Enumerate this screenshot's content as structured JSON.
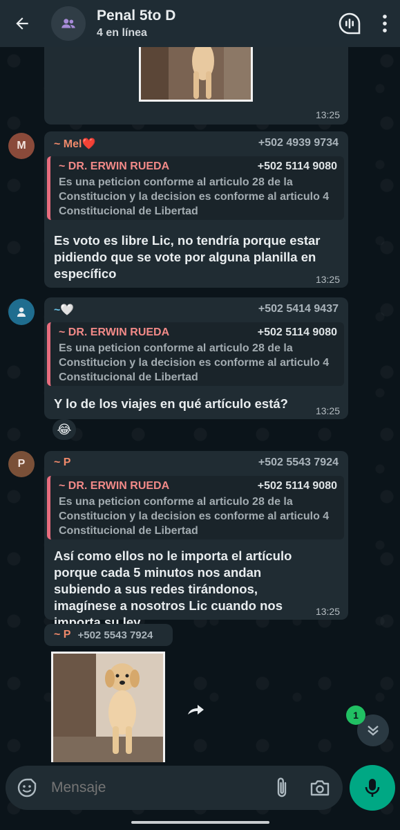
{
  "header": {
    "title": "Penal 5to D",
    "subtitle": "4 en línea"
  },
  "messages": [
    {
      "time": "13:25"
    },
    {
      "avatar_letter": "M",
      "sender": "~ Mel❤️",
      "phone": "+502 4939 9734",
      "quote_author": "~ DR. ERWIN RUEDA",
      "quote_phone": "+502 5114 9080",
      "quote_text": "Es una peticion conforme al articulo 28 de la Constitucion y la decision es conforme al articulo 4 Constitucional de  Libertad",
      "text": "Es voto es libre Lic, no tendría porque estar pidiendo que se vote por alguna planilla en específico",
      "time": "13:25"
    },
    {
      "sender": "~🤍",
      "phone": "+502 5414 9437",
      "quote_author": "~ DR. ERWIN RUEDA",
      "quote_phone": "+502 5114 9080",
      "quote_text": "Es una peticion conforme al articulo 28 de la Constitucion y la decision es conforme al articulo 4 Constitucional de  Libertad",
      "text": "Y lo de los viajes en qué artículo está?",
      "time": "13:25",
      "reaction": "😂"
    },
    {
      "avatar_letter": "P",
      "sender": "~ P",
      "phone": "+502 5543 7924",
      "quote_author": "~ DR. ERWIN RUEDA",
      "quote_phone": "+502 5114 9080",
      "quote_text": "Es una peticion conforme al articulo 28 de la Constitucion y la decision es conforme al articulo 4 Constitucional de  Libertad",
      "text": "Así como ellos no le importa el artículo porque cada 5 minutos nos andan subiendo a sus redes tirándonos, imagínese a nosotros Lic cuando nos importa su ley",
      "time": "13:25"
    },
    {
      "sender": "~ P",
      "phone": "+502 5543 7924"
    }
  ],
  "unread_count": "1",
  "composer": {
    "placeholder": "Mensaje"
  },
  "colors": {
    "header_bg": "#1f2c34",
    "bubble_bg": "#202c33",
    "accent_green": "#00a884",
    "quote_bar": "#e86d7e"
  },
  "icons": [
    "back-arrow-icon",
    "group-icon",
    "voice-chat-icon",
    "more-vert-icon",
    "forward-icon",
    "chevron-down-icon",
    "sticker-icon",
    "attach-icon",
    "camera-icon",
    "mic-icon",
    "person-icon"
  ]
}
